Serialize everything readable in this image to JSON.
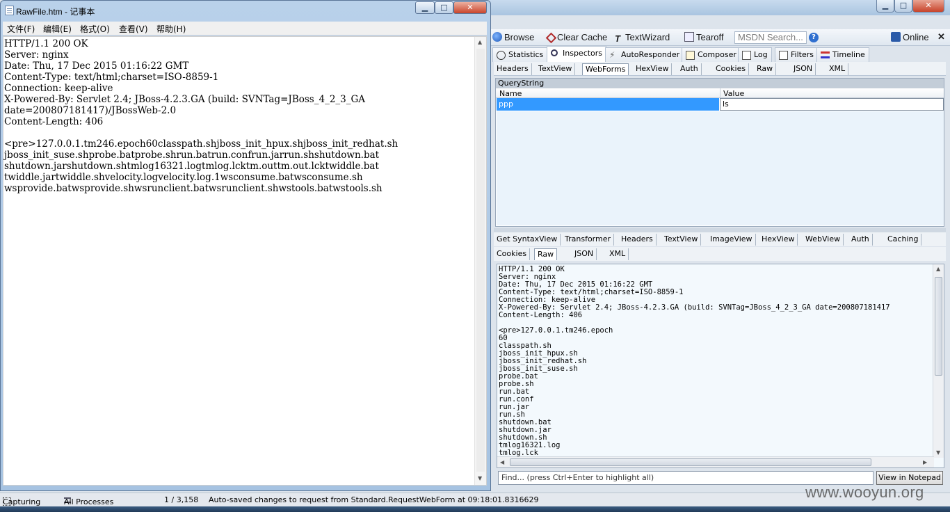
{
  "notepad": {
    "title": "RawFile.htm - 记事本",
    "buttons": {
      "minimize": "▁",
      "maximize": "□",
      "close": "✕"
    },
    "menu": [
      "文件(F)",
      "编辑(E)",
      "格式(O)",
      "查看(V)",
      "帮助(H)"
    ],
    "content": "HTTP/1.1 200 OK\nServer: nginx\nDate: Thu, 17 Dec 2015 01:16:22 GMT\nContent-Type: text/html;charset=ISO-8859-1\nConnection: keep-alive\nX-Powered-By: Servlet 2.4; JBoss-4.2.3.GA (build: SVNTag=JBoss_4_2_3_GA\ndate=200807181417)/JBossWeb-2.0\nContent-Length: 406\n\n<pre>127.0.0.1.tm246.epoch60classpath.shjboss_init_hpux.shjboss_init_redhat.sh\njboss_init_suse.shprobe.batprobe.shrun.batrun.confrun.jarrun.shshutdown.bat\nshutdown.jarshutdown.shtmlog16321.logtmlog.lcktm.outtm.out.lcktwiddle.bat\ntwiddle.jartwiddle.shvelocity.logvelocity.log.1wsconsume.batwsconsume.sh\nwsprovide.batwsprovide.shwsrunclient.batwsrunclient.shwstools.batwstools.sh"
  },
  "fiddler": {
    "window_buttons": {
      "minimize": "▁",
      "maximize": "□",
      "close": "✕"
    },
    "toolbar": {
      "browse": "Browse",
      "clear_cache": "Clear Cache",
      "textwizard": "TextWizard",
      "tearoff": "Tearoff",
      "msdn_search": "MSDN Search...",
      "help": "?",
      "online": "Online",
      "close": "✕"
    },
    "main_tabs": [
      "Statistics",
      "Inspectors",
      "AutoResponder",
      "Composer",
      "Log",
      "Filters",
      "Timeline"
    ],
    "request_tabs": [
      "Headers",
      "TextView",
      "WebForms",
      "HexView",
      "Auth",
      "Cookies",
      "Raw",
      "JSON",
      "XML"
    ],
    "querystring": {
      "header": "QueryString",
      "col_name": "Name",
      "col_value": "Value",
      "row_name": "ppp",
      "row_value": "ls"
    },
    "response_tabs_row1": [
      "Get SyntaxView",
      "Transformer",
      "Headers",
      "TextView",
      "ImageView",
      "HexView",
      "WebView",
      "Auth",
      "Caching"
    ],
    "response_tabs_row2": [
      "Cookies",
      "Raw",
      "JSON",
      "XML"
    ],
    "raw_text": "HTTP/1.1 200 OK\nServer: nginx\nDate: Thu, 17 Dec 2015 01:16:22 GMT\nContent-Type: text/html;charset=ISO-8859-1\nConnection: keep-alive\nX-Powered-By: Servlet 2.4; JBoss-4.2.3.GA (build: SVNTag=JBoss_4_2_3_GA date=200807181417\nContent-Length: 406\n\n<pre>127.0.0.1.tm246.epoch\n60\nclasspath.sh\njboss_init_hpux.sh\njboss_init_redhat.sh\njboss_init_suse.sh\nprobe.bat\nprobe.sh\nrun.bat\nrun.conf\nrun.jar\nrun.sh\nshutdown.bat\nshutdown.jar\nshutdown.sh\ntmlog16321.log\ntmlog.lck",
    "find_placeholder": "Find... (press Ctrl+Enter to highlight all)",
    "view_in_notepad": "View in Notepad",
    "status": {
      "capturing": "Capturing",
      "processes": "All Processes",
      "count": "1 / 3,158",
      "message": "Auto-saved changes to request from Standard.RequestWebForm at 09:18:01.8316629"
    }
  },
  "watermark": "www.wooyun.org"
}
